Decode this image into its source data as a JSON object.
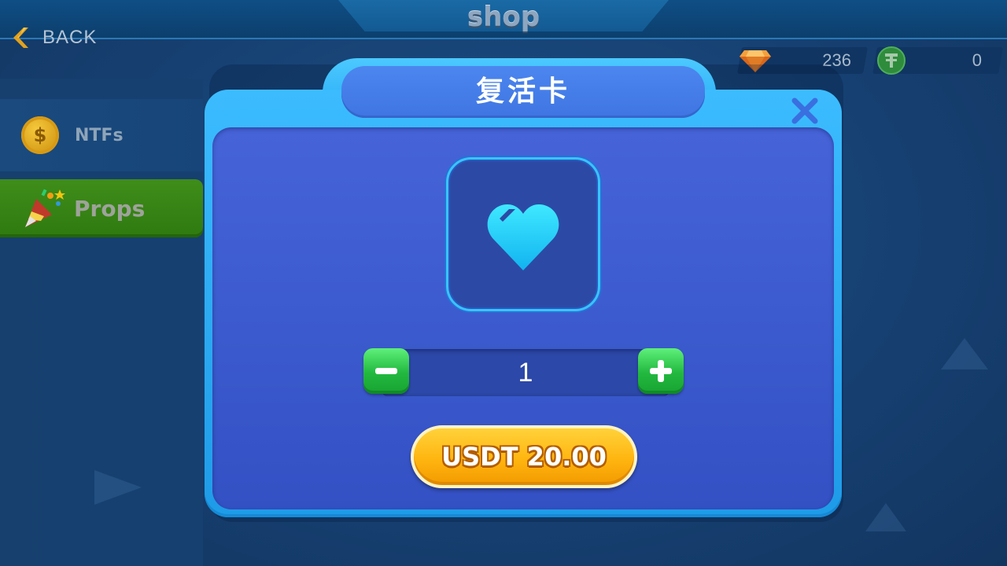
{
  "header": {
    "title": "shop",
    "back_label": "BACK"
  },
  "currencies": [
    {
      "icon": "diamond-icon",
      "value": "236"
    },
    {
      "icon": "tether-coin-icon",
      "value": "0"
    }
  ],
  "sidebar": {
    "items": [
      {
        "label": "NTFs",
        "icon": "gold-coin-icon",
        "selected": false
      },
      {
        "label": "Props",
        "icon": "party-popper-icon",
        "selected": true
      }
    ]
  },
  "dialog": {
    "title": "复活卡",
    "item_icon": "heart-icon",
    "quantity": "1",
    "buy_label": "USDT 20.00"
  },
  "colors": {
    "dialog_frame": "#3cbcff",
    "dialog_body": "#4664d8",
    "buy_button": "#ffb510",
    "stepper_button": "#22b83f",
    "selected_tab": "#3f8d1a"
  }
}
